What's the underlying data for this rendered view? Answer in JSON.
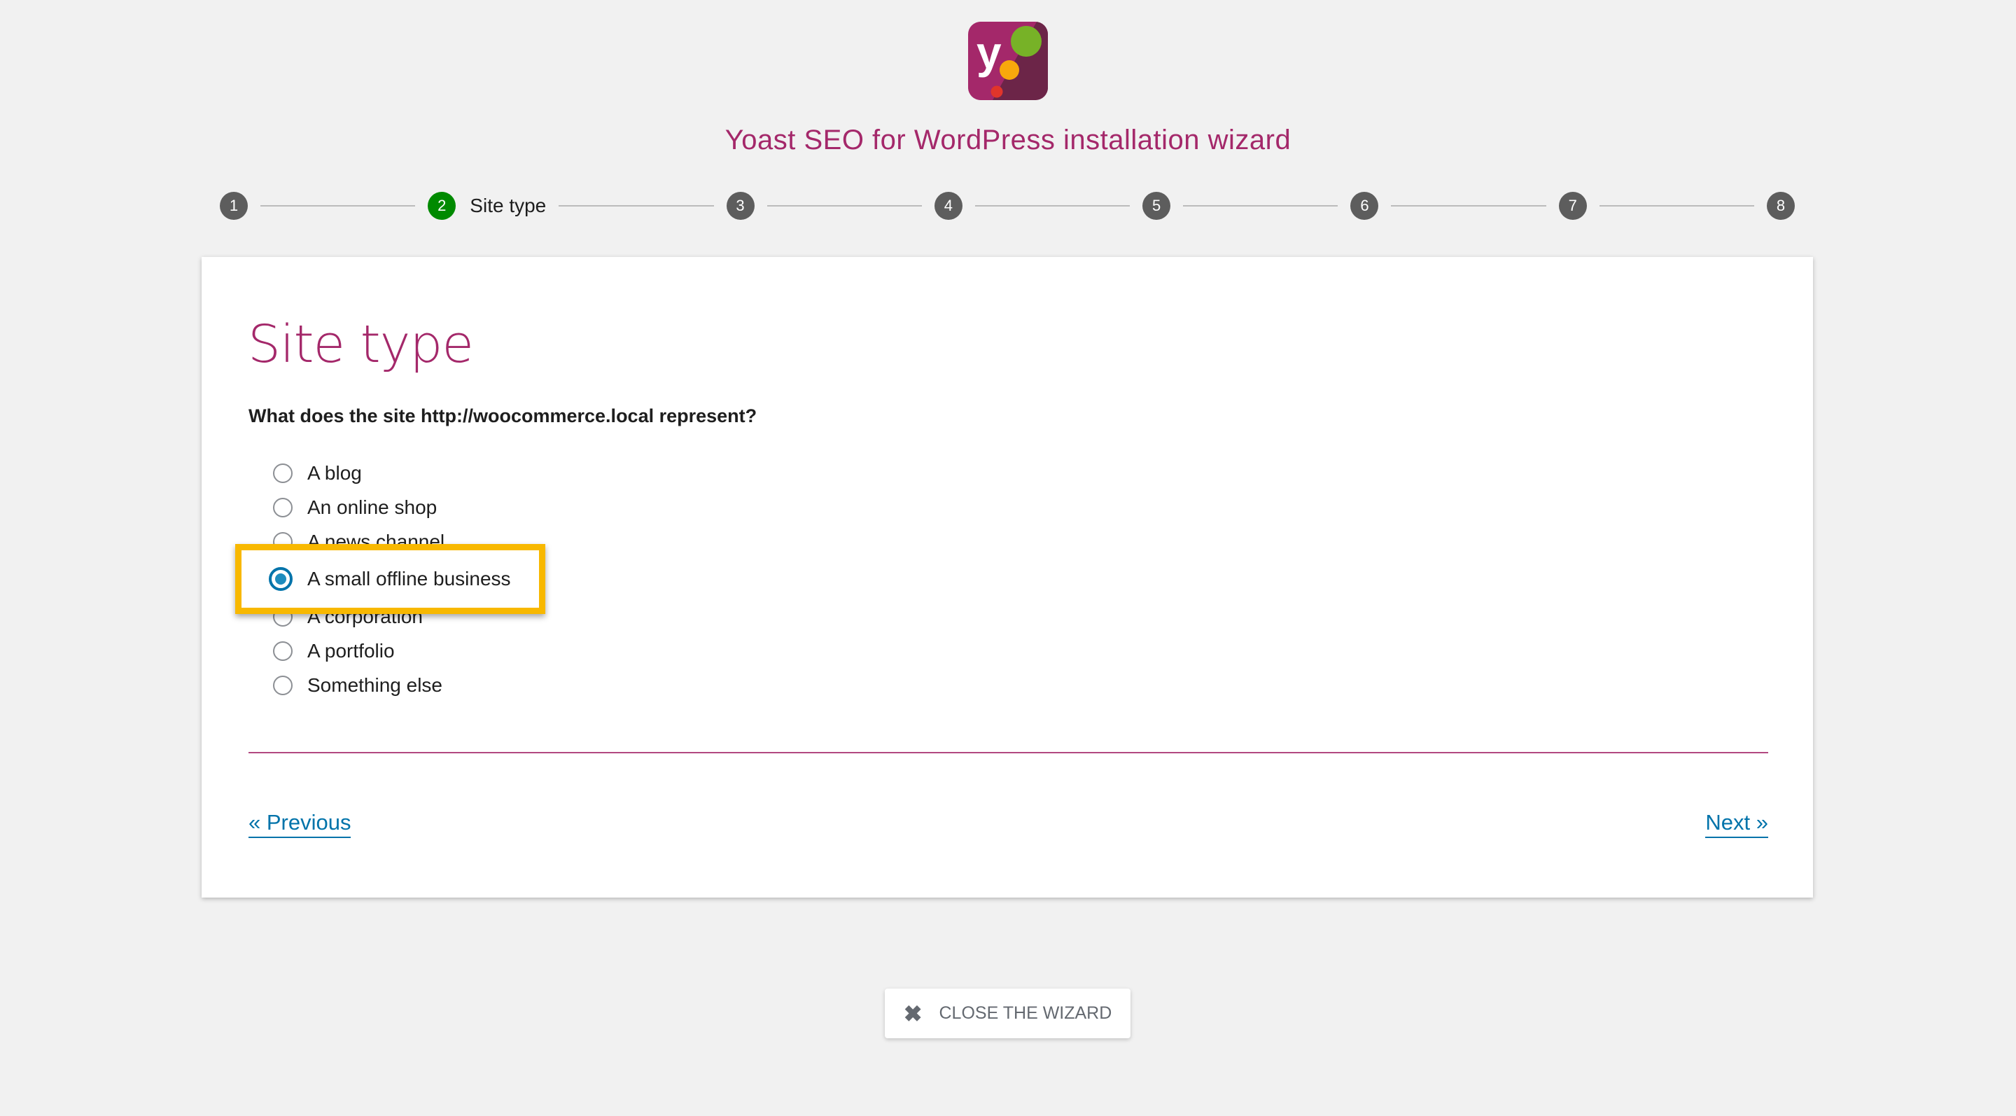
{
  "header": {
    "logo_text": "y",
    "title": "Yoast SEO for WordPress installation wizard"
  },
  "stepper": {
    "steps": [
      {
        "number": "1",
        "label": ""
      },
      {
        "number": "2",
        "label": "Site type",
        "active": true
      },
      {
        "number": "3",
        "label": ""
      },
      {
        "number": "4",
        "label": ""
      },
      {
        "number": "5",
        "label": ""
      },
      {
        "number": "6",
        "label": ""
      },
      {
        "number": "7",
        "label": ""
      },
      {
        "number": "8",
        "label": ""
      }
    ],
    "active_color": "#008a00",
    "inactive_color": "#5d5d5d"
  },
  "card": {
    "heading": "Site type",
    "question": "What does the site http://woocommerce.local represent?",
    "options": [
      {
        "label": "A blog",
        "selected": false
      },
      {
        "label": "An online shop",
        "selected": false
      },
      {
        "label": "A news channel",
        "selected": false
      },
      {
        "label": "A small offline business",
        "selected": true
      },
      {
        "label": "A corporation",
        "selected": false
      },
      {
        "label": "A portfolio",
        "selected": false
      },
      {
        "label": "Something else",
        "selected": false
      }
    ],
    "highlight_color": "#f8b800",
    "previous_label": "« Previous",
    "next_label": "Next »"
  },
  "footer": {
    "close_icon": "close-x-icon",
    "close_label": "CLOSE THE WIZARD"
  },
  "colors": {
    "brand": "#a4286a",
    "link": "#0073aa"
  }
}
